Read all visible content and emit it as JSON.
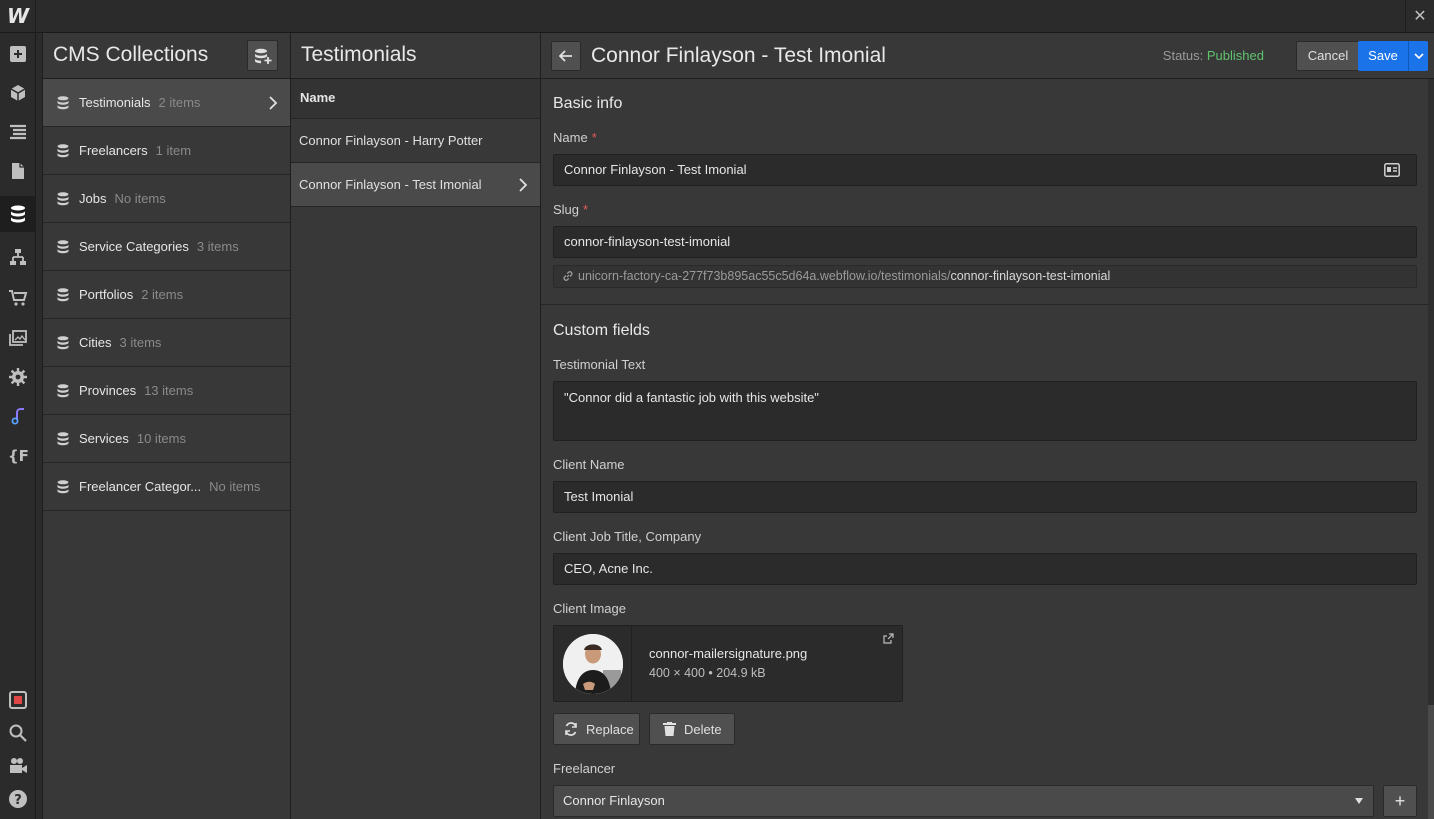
{
  "app": {
    "logo_letter": "W",
    "close_glyph": "✕"
  },
  "rail": [
    {
      "icon": "add-panel-icon"
    },
    {
      "icon": "box-icon"
    },
    {
      "icon": "navigator-icon"
    },
    {
      "icon": "pages-icon"
    },
    {
      "icon": "cms-database-icon",
      "active": true
    },
    {
      "icon": "logic-flow-icon"
    },
    {
      "icon": "ecommerce-cart-icon"
    },
    {
      "icon": "assets-images-icon"
    },
    {
      "icon": "settings-gear-icon"
    },
    {
      "icon": "audit-icon"
    },
    {
      "icon": "finsweet-icon"
    },
    {
      "icon": "record-icon"
    },
    {
      "icon": "search-icon"
    },
    {
      "icon": "video-camera-icon"
    },
    {
      "icon": "help-icon"
    }
  ],
  "collections": {
    "title": "CMS Collections",
    "items": [
      {
        "name": "Testimonials",
        "count": "2 items",
        "active": true
      },
      {
        "name": "Freelancers",
        "count": "1 item"
      },
      {
        "name": "Jobs",
        "count": "No items"
      },
      {
        "name": "Service Categories",
        "count": "3 items"
      },
      {
        "name": "Portfolios",
        "count": "2 items"
      },
      {
        "name": "Cities",
        "count": "3 items"
      },
      {
        "name": "Provinces",
        "count": "13 items"
      },
      {
        "name": "Services",
        "count": "10 items"
      },
      {
        "name": "Freelancer Categor...",
        "count": "No items"
      }
    ]
  },
  "items_list": {
    "title": "Testimonials",
    "column_header": "Name",
    "rows": [
      {
        "name": "Connor Finlayson - Harry Potter"
      },
      {
        "name": "Connor Finlayson - Test Imonial",
        "active": true
      }
    ]
  },
  "detail": {
    "title": "Connor Finlayson - Test Imonial",
    "status_label": "Status:",
    "status_value": "Published",
    "cancel_label": "Cancel",
    "save_label": "Save",
    "basic_info_title": "Basic info",
    "name_label": "Name",
    "name_value": "Connor Finlayson - Test Imonial",
    "slug_label": "Slug",
    "slug_value": "connor-finlayson-test-imonial",
    "required_mark": "*",
    "url_base": "unicorn-factory-ca-277f73b895ac55c5d64a.webflow.io/testimonials/",
    "url_slug": "connor-finlayson-test-imonial",
    "custom_fields_title": "Custom fields",
    "testimonial_label": "Testimonial Text",
    "testimonial_value": "\"Connor did a fantastic job with this website\"",
    "client_name_label": "Client Name",
    "client_name_value": "Test Imonial",
    "client_job_label": "Client Job Title, Company",
    "client_job_value": "CEO, Acne Inc.",
    "client_image_label": "Client Image",
    "image_filename": "connor-mailersignature.png",
    "image_meta": "400 × 400 • 204.9 kB",
    "replace_label": "Replace",
    "delete_label": "Delete",
    "freelancer_label": "Freelancer",
    "freelancer_value": "Connor Finlayson",
    "add_label": "+"
  },
  "colors": {
    "accent": "#1a73e8",
    "published": "#61c26e",
    "required": "#e55a5a"
  }
}
